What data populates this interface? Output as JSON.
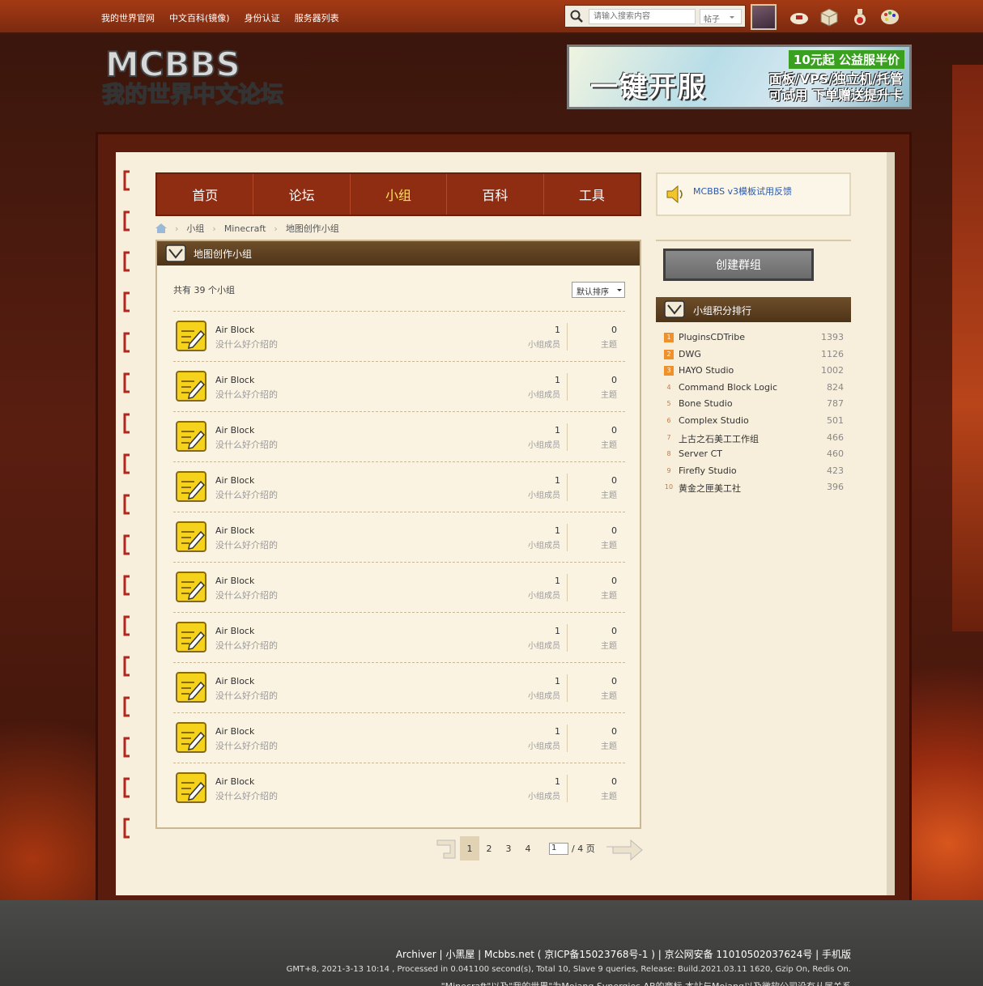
{
  "topnav": [
    "我的世界官网",
    "中文百科(镜像)",
    "身份认证",
    "服务器列表"
  ],
  "search": {
    "placeholder": "请输入搜索内容",
    "type": "帖子"
  },
  "logo": {
    "line1": "MCBBS",
    "line2": "我的世界中文论坛"
  },
  "banner": {
    "promo": "10元起 公益服半价",
    "title": "一键开服",
    "sub1": "面板/VPS/独立机/托管",
    "sub2": "可试用 下单赠送提升卡"
  },
  "nav": [
    "首页",
    "论坛",
    "小组",
    "百科",
    "工具"
  ],
  "nav_current": 2,
  "breadcrumb": [
    "小组",
    "Minecraft",
    "地图创作小组"
  ],
  "box": {
    "title": "地图创作小组",
    "count": "共有 39 个小组",
    "sort": "默认排序"
  },
  "groups": [
    {
      "name": "Air Block",
      "desc": "没什么好介绍的",
      "members": "1",
      "members_label": "小组成员",
      "topics": "0",
      "topics_label": "主题"
    },
    {
      "name": "Air Block",
      "desc": "没什么好介绍的",
      "members": "1",
      "members_label": "小组成员",
      "topics": "0",
      "topics_label": "主题"
    },
    {
      "name": "Air Block",
      "desc": "没什么好介绍的",
      "members": "1",
      "members_label": "小组成员",
      "topics": "0",
      "topics_label": "主题"
    },
    {
      "name": "Air Block",
      "desc": "没什么好介绍的",
      "members": "1",
      "members_label": "小组成员",
      "topics": "0",
      "topics_label": "主题"
    },
    {
      "name": "Air Block",
      "desc": "没什么好介绍的",
      "members": "1",
      "members_label": "小组成员",
      "topics": "0",
      "topics_label": "主题"
    },
    {
      "name": "Air Block",
      "desc": "没什么好介绍的",
      "members": "1",
      "members_label": "小组成员",
      "topics": "0",
      "topics_label": "主题"
    },
    {
      "name": "Air Block",
      "desc": "没什么好介绍的",
      "members": "1",
      "members_label": "小组成员",
      "topics": "0",
      "topics_label": "主题"
    },
    {
      "name": "Air Block",
      "desc": "没什么好介绍的",
      "members": "1",
      "members_label": "小组成员",
      "topics": "0",
      "topics_label": "主题"
    },
    {
      "name": "Air Block",
      "desc": "没什么好介绍的",
      "members": "1",
      "members_label": "小组成员",
      "topics": "0",
      "topics_label": "主题"
    },
    {
      "name": "Air Block",
      "desc": "没什么好介绍的",
      "members": "1",
      "members_label": "小组成员",
      "topics": "0",
      "topics_label": "主题"
    }
  ],
  "pager": {
    "pages": [
      "1",
      "2",
      "3",
      "4"
    ],
    "current": "1",
    "input": "1",
    "total": "/ 4 页"
  },
  "announce": "MCBBS v3模板试用反馈",
  "create_button": "创建群组",
  "ranking": {
    "title": "小组积分排行",
    "items": [
      {
        "no": "1",
        "name": "PluginsCDTribe",
        "score": "1393"
      },
      {
        "no": "2",
        "name": "DWG",
        "score": "1126"
      },
      {
        "no": "3",
        "name": "HAYO Studio",
        "score": "1002"
      },
      {
        "no": "4",
        "name": "Command Block Logic",
        "score": "824"
      },
      {
        "no": "5",
        "name": "Bone Studio",
        "score": "787"
      },
      {
        "no": "6",
        "name": "Complex Studio",
        "score": "501"
      },
      {
        "no": "7",
        "name": "上古之石美工工作组",
        "score": "466"
      },
      {
        "no": "8",
        "name": "Server CT",
        "score": "460"
      },
      {
        "no": "9",
        "name": "Firefly Studio",
        "score": "423"
      },
      {
        "no": "10",
        "name": "黄金之匣美工社",
        "score": "396"
      }
    ]
  },
  "footer": {
    "line1": "Archiver | 小黑屋 | Mcbbs.net ( 京ICP备15023768号-1 ) | 京公网安备 11010502037624号 | 手机版",
    "line2": "GMT+8, 2021-3-13 10:14 , Processed in 0.041100 second(s), Total 10, Slave 9 queries, Release: Build.2021.03.11 1620, Gzip On, Redis On.",
    "line3": "\"Minecraft\"以及\"我的世界\"为Mojang Synergies AB的商标 本站与Mojang以及微软公司没有从属关系"
  },
  "colors": {
    "accent": "#8f2d13",
    "highlight": "#fde05a",
    "link": "#2b59a8"
  }
}
